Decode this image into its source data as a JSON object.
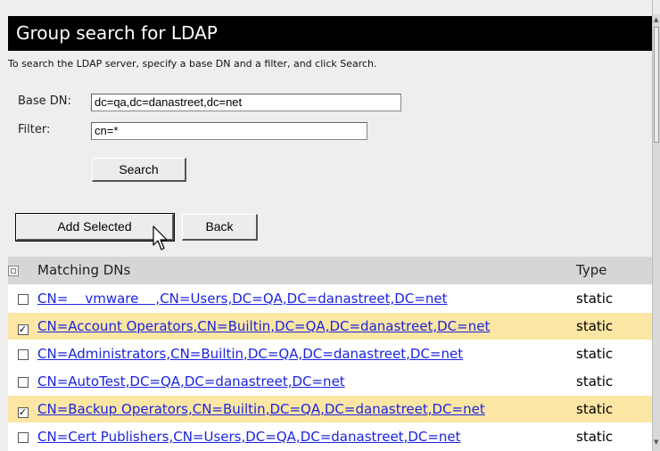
{
  "page": {
    "title": "Group search for LDAP",
    "description": "To search the LDAP server, specify a base DN and a filter, and click Search."
  },
  "form": {
    "base_dn_label": "Base DN:",
    "base_dn_value": "dc=qa,dc=danastreet,dc=net",
    "filter_label": "Filter:",
    "filter_value": "cn=*",
    "search_label": "Search"
  },
  "actions": {
    "add_selected_label": "Add Selected",
    "back_label": "Back"
  },
  "results": {
    "headers": {
      "dn": "Matching DNs",
      "type": "Type"
    },
    "rows": [
      {
        "dn": "CN=    vmware    ,CN=Users,DC=QA,DC=danastreet,DC=net",
        "type": "static",
        "checked": false
      },
      {
        "dn": "CN=Account Operators,CN=Builtin,DC=QA,DC=danastreet,DC=net",
        "type": "static",
        "checked": true
      },
      {
        "dn": "CN=Administrators,CN=Builtin,DC=QA,DC=danastreet,DC=net",
        "type": "static",
        "checked": false
      },
      {
        "dn": "CN=AutoTest,DC=QA,DC=danastreet,DC=net",
        "type": "static",
        "checked": false
      },
      {
        "dn": "CN=Backup Operators,CN=Builtin,DC=QA,DC=danastreet,DC=net",
        "type": "static",
        "checked": true
      },
      {
        "dn": "CN=Cert Publishers,CN=Users,DC=QA,DC=danastreet,DC=net",
        "type": "static",
        "checked": false
      }
    ]
  },
  "colors": {
    "title_bg": "#000000",
    "selected_row": "#fce6a4",
    "link": "#1b24e0",
    "header_row": "#d6d6d6"
  },
  "icons": {
    "select_all": "select-all-checkbox-icon",
    "cursor": "mouse-pointer-icon"
  }
}
